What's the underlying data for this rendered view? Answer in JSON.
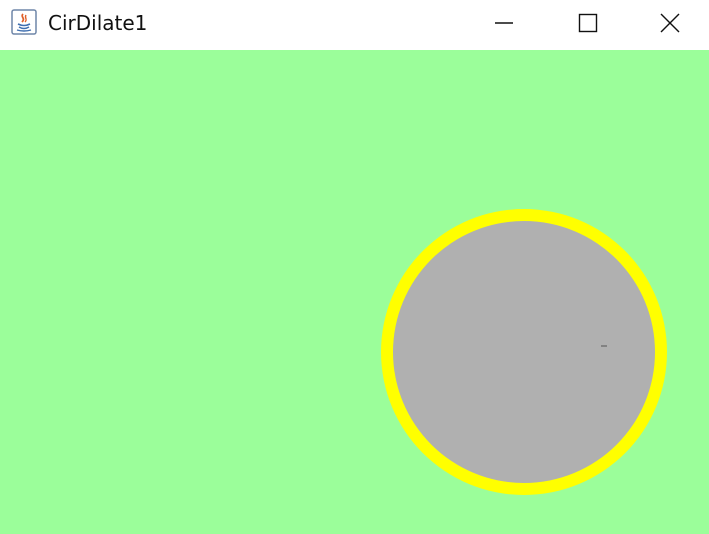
{
  "window": {
    "title": "CirDilate1",
    "controls": {
      "minimize_icon": "minimize-icon",
      "maximize_icon": "maximize-icon",
      "close_icon": "close-icon"
    }
  },
  "canvas": {
    "background_color": "#9bfe9a",
    "circle": {
      "fill_color": "#b0b0b0",
      "ring_color": "#ffff00"
    }
  }
}
